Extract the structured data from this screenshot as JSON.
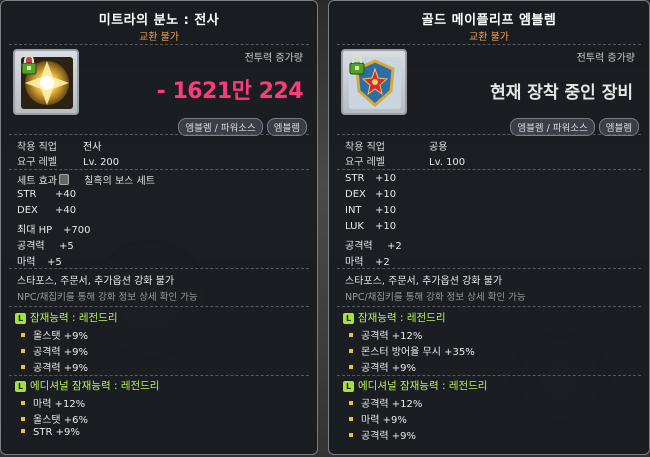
{
  "left": {
    "title": "미트라의 분노 : 전사",
    "trade": "교환 불가",
    "power_label": "전투력 증가량",
    "power_value": "- 1621만 224",
    "tags": [
      "엠블렘 / 파워소스",
      "엠블렘"
    ],
    "req": [
      {
        "k": "착용 직업",
        "v": "전사"
      },
      {
        "k": "요구 레벨",
        "v": "Lv. 200"
      }
    ],
    "set_label": "세트 효과",
    "set_value": "칠흑의 보스 세트",
    "stats": [
      {
        "k": "STR",
        "v": "+40"
      },
      {
        "k": "DEX",
        "v": "+40"
      },
      {
        "k": "최대 HP",
        "v": "+700"
      },
      {
        "k": "공격력",
        "v": "+5"
      },
      {
        "k": "마력",
        "v": "+5"
      }
    ],
    "sf_text": "스타포스, 주문서, 추가옵션 강화 불가",
    "sf_sub": "NPC/채집키를 통해 강화 정보 상세 확인 가능",
    "potential_head": "잠재능력 : 레전드리",
    "potential": [
      "올스탯 +9%",
      "공격력 +9%",
      "공격력 +9%"
    ],
    "additional_head": "에디셔널 잠재능력 : 레전드리",
    "additional": [
      "마력 +12%",
      "올스탯 +6%",
      "STR +9%"
    ]
  },
  "right": {
    "title": "골드 메이플리프 엠블렘",
    "trade": "교환 불가",
    "power_label": "전투력 증가량",
    "power_equipped": "현재 장착 중인 장비",
    "tags": [
      "엠블렘 / 파워소스",
      "엠블렘"
    ],
    "req": [
      {
        "k": "착용 직업",
        "v": "공용"
      },
      {
        "k": "요구 레벨",
        "v": "Lv. 100"
      }
    ],
    "stats": [
      {
        "k": "STR",
        "v": "+10"
      },
      {
        "k": "DEX",
        "v": "+10"
      },
      {
        "k": "INT",
        "v": "+10"
      },
      {
        "k": "LUK",
        "v": "+10"
      },
      {
        "k": "공격력",
        "v": "+2"
      },
      {
        "k": "마력",
        "v": "+2"
      }
    ],
    "sf_text": "스타포스, 주문서, 추가옵션 강화 불가",
    "sf_sub": "NPC/채집키를 통해 강화 정보 상세 확인 가능",
    "potential_head": "잠재능력 : 레전드리",
    "potential": [
      "공격력 +12%",
      "몬스터 방어율 무시 +35%",
      "공격력 +9%"
    ],
    "additional_head": "에디셔널 잠재능력 : 레전드리",
    "additional": [
      "공격력 +12%",
      "마력 +9%",
      "공격력 +9%"
    ]
  },
  "badge_letter": "L",
  "colors": {
    "power": "#ff3a7a",
    "trade": "#f2a24a",
    "legendary": "#b9f15a"
  }
}
